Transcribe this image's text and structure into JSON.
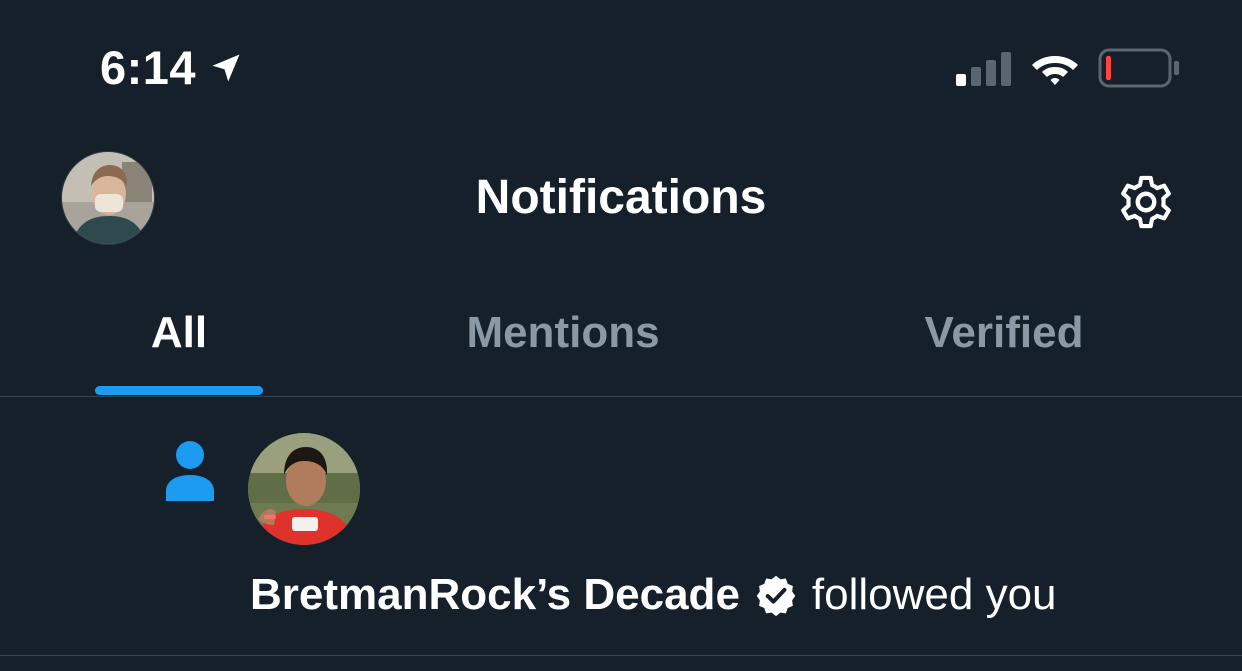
{
  "status_bar": {
    "time": "6:14",
    "icons": [
      "location-arrow-icon",
      "cellular-signal-icon",
      "wifi-icon",
      "battery-low-icon"
    ],
    "battery_color": "#ff453a"
  },
  "header": {
    "title": "Notifications",
    "avatar": "profile-avatar",
    "settings_icon": "gear-icon"
  },
  "tabs": [
    {
      "label": "All",
      "active": true
    },
    {
      "label": "Mentions",
      "active": false
    },
    {
      "label": "Verified",
      "active": false
    }
  ],
  "notifications": [
    {
      "type": "follow",
      "icon": "person-icon",
      "user_name": "BretmanRock’s Decade",
      "verified": true,
      "action_text": "followed you"
    }
  ],
  "colors": {
    "background": "#15202b",
    "accent": "#1d9bf0",
    "divider": "#38444d",
    "inactive_tab": "#8b98a5",
    "text": "#ffffff"
  }
}
